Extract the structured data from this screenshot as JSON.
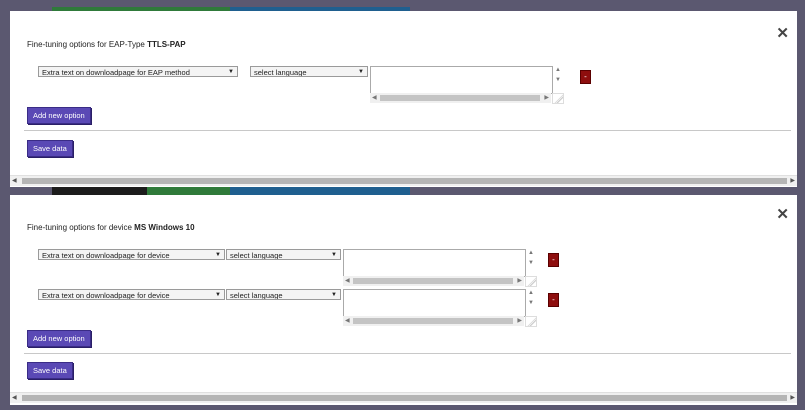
{
  "colors": {
    "overlay": "#5b5870",
    "strip_green": "#2f7a3a",
    "strip_blue": "#1f5f8f",
    "button": "#5a49b5",
    "delete_button": "#8e0e0e"
  },
  "dialogs": [
    {
      "title_prefix": "Fine-tuning options for EAP-Type ",
      "title_bold": "TTLS-PAP",
      "close": "✕",
      "rows": [
        {
          "option": "Extra text on downloadpage for EAP method",
          "language": "select language",
          "delete": "-"
        }
      ],
      "add_label": "Add new option",
      "save_label": "Save data"
    },
    {
      "title_prefix": "Fine-tuning options for device ",
      "title_bold": "MS Windows 10",
      "close": "✕",
      "rows": [
        {
          "option": "Extra text on downloadpage for device",
          "language": "select language",
          "delete": "-"
        },
        {
          "option": "Extra text on downloadpage for device",
          "language": "select language",
          "delete": "-"
        }
      ],
      "add_label": "Add new option",
      "save_label": "Save data"
    }
  ],
  "glyphs": {
    "arrow_down": "▼",
    "arrow_up_small": "▲",
    "arrow_down_small": "▼",
    "arrow_left": "◀",
    "arrow_right": "▶"
  }
}
